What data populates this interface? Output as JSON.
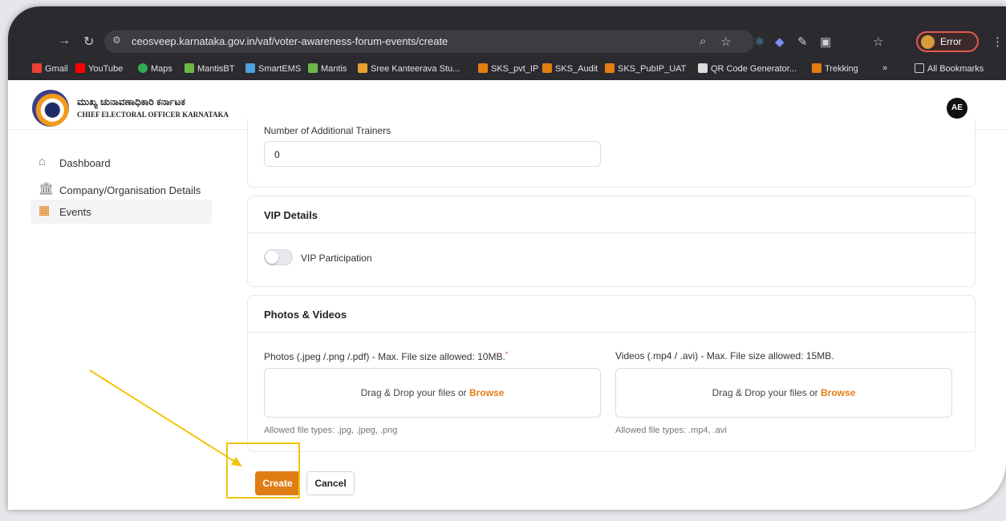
{
  "browser": {
    "url": "ceosveep.karnataka.gov.in/vaf/voter-awareness-forum-events/create",
    "profile_label": "Error",
    "bookmarks": [
      "Gmail",
      "YouTube",
      "Maps",
      "MantisBT",
      "SmartEMS",
      "Mantis",
      "Sree Kanteerava Stu...",
      "SKS_pvt_IP",
      "SKS_Audit",
      "SKS_PubIP_UAT",
      "QR Code Generator...",
      "Trekking",
      "»",
      "All Bookmarks"
    ]
  },
  "header": {
    "org_name_kannada": "ಮುಖ್ಯ ಚುನಾವಣಾಧಿಕಾರಿ ಕರ್ನಾಟಕ",
    "org_name_english": "CHIEF ELECTORAL OFFICER KARNATAKA",
    "user_initials": "AE"
  },
  "sidebar": {
    "items": [
      {
        "label": "Dashboard",
        "icon": "home-icon"
      },
      {
        "label": "Company/Organisation Details",
        "icon": "bank-icon"
      },
      {
        "label": "Events",
        "icon": "calendar-icon",
        "active": true
      }
    ]
  },
  "trainers": {
    "label": "Number of Additional Trainers",
    "value": "0"
  },
  "vip": {
    "title": "VIP Details",
    "toggle_label": "VIP Participation",
    "toggle_on": false
  },
  "media": {
    "title": "Photos & Videos",
    "photos_label": "Photos (.jpeg /.png /.pdf) - Max. File size allowed: 10MB.",
    "photos_required_mark": "*",
    "videos_label": "Videos (.mp4 / .avi) - Max. File size allowed: 15MB.",
    "drop_text": "Drag & Drop your files or ",
    "browse_text": "Browse",
    "photos_hint": "Allowed file types: .jpg, .jpeg, .png",
    "videos_hint": "Allowed file types: .mp4, .avi"
  },
  "actions": {
    "create_label": "Create",
    "cancel_label": "Cancel"
  },
  "colors": {
    "accent": "#df7d14",
    "annotation": "#f2c40b"
  }
}
